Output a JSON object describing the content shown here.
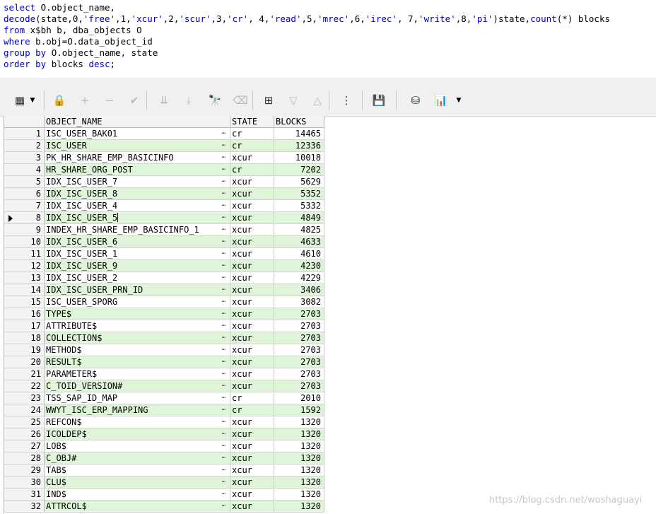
{
  "sql_lines": [
    [
      {
        "t": "select",
        "k": "kw"
      },
      {
        "t": " O.object_name,",
        "k": ""
      }
    ],
    [
      {
        "t": "decode",
        "k": "kw"
      },
      {
        "t": "(state,0,",
        "k": ""
      },
      {
        "t": "'free'",
        "k": "str"
      },
      {
        "t": ",1,",
        "k": ""
      },
      {
        "t": "'xcur'",
        "k": "str"
      },
      {
        "t": ",2,",
        "k": ""
      },
      {
        "t": "'scur'",
        "k": "str"
      },
      {
        "t": ",3,",
        "k": ""
      },
      {
        "t": "'cr'",
        "k": "str"
      },
      {
        "t": ", 4,",
        "k": ""
      },
      {
        "t": "'read'",
        "k": "str"
      },
      {
        "t": ",5,",
        "k": ""
      },
      {
        "t": "'mrec'",
        "k": "str"
      },
      {
        "t": ",6,",
        "k": ""
      },
      {
        "t": "'irec'",
        "k": "str"
      },
      {
        "t": ", 7,",
        "k": ""
      },
      {
        "t": "'write'",
        "k": "str"
      },
      {
        "t": ",8,",
        "k": ""
      },
      {
        "t": "'pi'",
        "k": "str"
      },
      {
        "t": ")state,",
        "k": ""
      },
      {
        "t": "count",
        "k": "kw"
      },
      {
        "t": "(*) blocks",
        "k": ""
      }
    ],
    [
      {
        "t": "from",
        "k": "kw"
      },
      {
        "t": " x$bh b, dba_objects O",
        "k": ""
      }
    ],
    [
      {
        "t": "where",
        "k": "kw"
      },
      {
        "t": " b.obj=O.data_object_id",
        "k": ""
      }
    ],
    [
      {
        "t": "group by",
        "k": "kw"
      },
      {
        "t": " O.object_name, state",
        "k": ""
      }
    ],
    [
      {
        "t": "order by",
        "k": "kw"
      },
      {
        "t": " blocks ",
        "k": ""
      },
      {
        "t": "desc",
        "k": "kw"
      },
      {
        "t": ";",
        "k": ""
      }
    ]
  ],
  "toolbar": {
    "buttons": [
      {
        "name": "grid-view-icon",
        "glyph": "▦",
        "enabled": true
      },
      {
        "name": "lock-icon",
        "glyph": "🔒",
        "enabled": true
      },
      {
        "name": "add-row-icon",
        "glyph": "+",
        "enabled": false
      },
      {
        "name": "delete-row-icon",
        "glyph": "−",
        "enabled": false
      },
      {
        "name": "post-changes-icon",
        "glyph": "✔",
        "enabled": false
      },
      {
        "name": "fetch-next-page-icon",
        "glyph": "⇊",
        "enabled": false
      },
      {
        "name": "fetch-last-page-icon",
        "glyph": "⤓",
        "enabled": false
      },
      {
        "name": "find-icon",
        "glyph": "🔭",
        "enabled": true
      },
      {
        "name": "clear-filter-icon",
        "glyph": "⌫",
        "enabled": false
      },
      {
        "name": "query-by-example-icon",
        "glyph": "⊞",
        "enabled": true
      },
      {
        "name": "sort-down-icon",
        "glyph": "▽",
        "enabled": false
      },
      {
        "name": "sort-up-icon",
        "glyph": "△",
        "enabled": false
      },
      {
        "name": "single-record-view-icon",
        "glyph": "⋮",
        "enabled": true
      },
      {
        "name": "save-icon",
        "glyph": "💾",
        "enabled": true
      },
      {
        "name": "export-icon",
        "glyph": "⛁",
        "enabled": true
      },
      {
        "name": "chart-icon",
        "glyph": "📊",
        "enabled": true
      }
    ],
    "colors": {
      "enabled": "#2a2a2a",
      "disabled": "#b8b8b8",
      "accent": "#1c5fa8"
    }
  },
  "grid": {
    "columns": [
      "OBJECT_NAME",
      "STATE",
      "BLOCKS"
    ],
    "current_row": 8,
    "rows": [
      [
        "ISC_USER_BAK01",
        "cr",
        "14465"
      ],
      [
        "ISC_USER",
        "cr",
        "12336"
      ],
      [
        "PK_HR_SHARE_EMP_BASICINFO",
        "xcur",
        "10018"
      ],
      [
        "HR_SHARE_ORG_POST",
        "cr",
        "7202"
      ],
      [
        "IDX_ISC_USER_7",
        "xcur",
        "5629"
      ],
      [
        "IDX_ISC_USER_8",
        "xcur",
        "5352"
      ],
      [
        "IDX_ISC_USER_4",
        "xcur",
        "5332"
      ],
      [
        "IDX_ISC_USER_5",
        "xcur",
        "4849"
      ],
      [
        "INDEX_HR_SHARE_EMP_BASICINFO_1",
        "xcur",
        "4825"
      ],
      [
        "IDX_ISC_USER_6",
        "xcur",
        "4633"
      ],
      [
        "IDX_ISC_USER_1",
        "xcur",
        "4610"
      ],
      [
        "IDX_ISC_USER_9",
        "xcur",
        "4230"
      ],
      [
        "IDX_ISC_USER_2",
        "xcur",
        "4229"
      ],
      [
        "IDX_ISC_USER_PRN_ID",
        "xcur",
        "3406"
      ],
      [
        "ISC_USER_SPORG",
        "xcur",
        "3082"
      ],
      [
        "TYPE$",
        "xcur",
        "2703"
      ],
      [
        "ATTRIBUTE$",
        "xcur",
        "2703"
      ],
      [
        "COLLECTION$",
        "xcur",
        "2703"
      ],
      [
        "METHOD$",
        "xcur",
        "2703"
      ],
      [
        "RESULT$",
        "xcur",
        "2703"
      ],
      [
        "PARAMETER$",
        "xcur",
        "2703"
      ],
      [
        "C_TOID_VERSION#",
        "xcur",
        "2703"
      ],
      [
        "TSS_SAP_ID_MAP",
        "cr",
        "2010"
      ],
      [
        "WWYT_ISC_ERP_MAPPING",
        "cr",
        "1592"
      ],
      [
        "REFCON$",
        "xcur",
        "1320"
      ],
      [
        "ICOLDEP$",
        "xcur",
        "1320"
      ],
      [
        "LOB$",
        "xcur",
        "1320"
      ],
      [
        "C_OBJ#",
        "xcur",
        "1320"
      ],
      [
        "TAB$",
        "xcur",
        "1320"
      ],
      [
        "CLU$",
        "xcur",
        "1320"
      ],
      [
        "IND$",
        "xcur",
        "1320"
      ],
      [
        "ATTRCOL$",
        "xcur",
        "1320"
      ]
    ],
    "colors": {
      "stripe": "#dff5d9",
      "header_bg": "#f3f3f3"
    }
  },
  "watermark": "https://blog.csdn.net/woshaguayi"
}
